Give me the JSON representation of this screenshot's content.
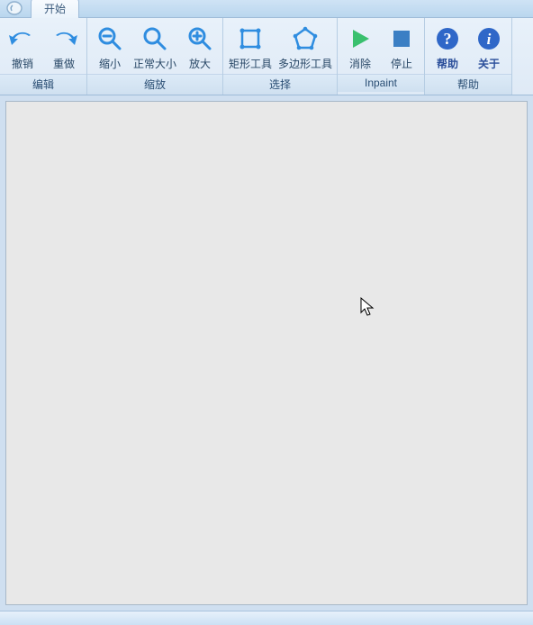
{
  "tab": {
    "label": "开始"
  },
  "colors": {
    "icon_blue": "#2f8de0",
    "icon_gray": "#7f99b3",
    "inpaint_green": "#39c06e",
    "stop_blue": "#3b7fc4",
    "help_blue": "#2f67c8",
    "info_blue": "#2f67c8"
  },
  "ribbon": {
    "groups": [
      {
        "title": "编辑",
        "buttons": [
          {
            "key": "undo",
            "label": "撤销",
            "icon": "undo-icon"
          },
          {
            "key": "redo",
            "label": "重做",
            "icon": "redo-icon"
          }
        ]
      },
      {
        "title": "缩放",
        "buttons": [
          {
            "key": "zoom_out",
            "label": "缩小",
            "icon": "zoom-out-icon"
          },
          {
            "key": "zoom_fit",
            "label": "正常大小",
            "icon": "zoom-fit-icon"
          },
          {
            "key": "zoom_in",
            "label": "放大",
            "icon": "zoom-in-icon"
          }
        ]
      },
      {
        "title": "选择",
        "buttons": [
          {
            "key": "rect_tool",
            "label": "矩形工具",
            "icon": "rectangle-icon"
          },
          {
            "key": "poly_tool",
            "label": "多边形工具",
            "icon": "polygon-icon"
          }
        ]
      },
      {
        "title": "Inpaint",
        "buttons": [
          {
            "key": "run",
            "label": "消除",
            "icon": "play-icon"
          },
          {
            "key": "stop",
            "label": "停止",
            "icon": "stop-icon"
          }
        ]
      },
      {
        "title": "帮助",
        "buttons": [
          {
            "key": "help",
            "label": "帮助",
            "icon": "help-icon"
          },
          {
            "key": "about",
            "label": "关于",
            "icon": "about-icon"
          }
        ]
      }
    ]
  }
}
